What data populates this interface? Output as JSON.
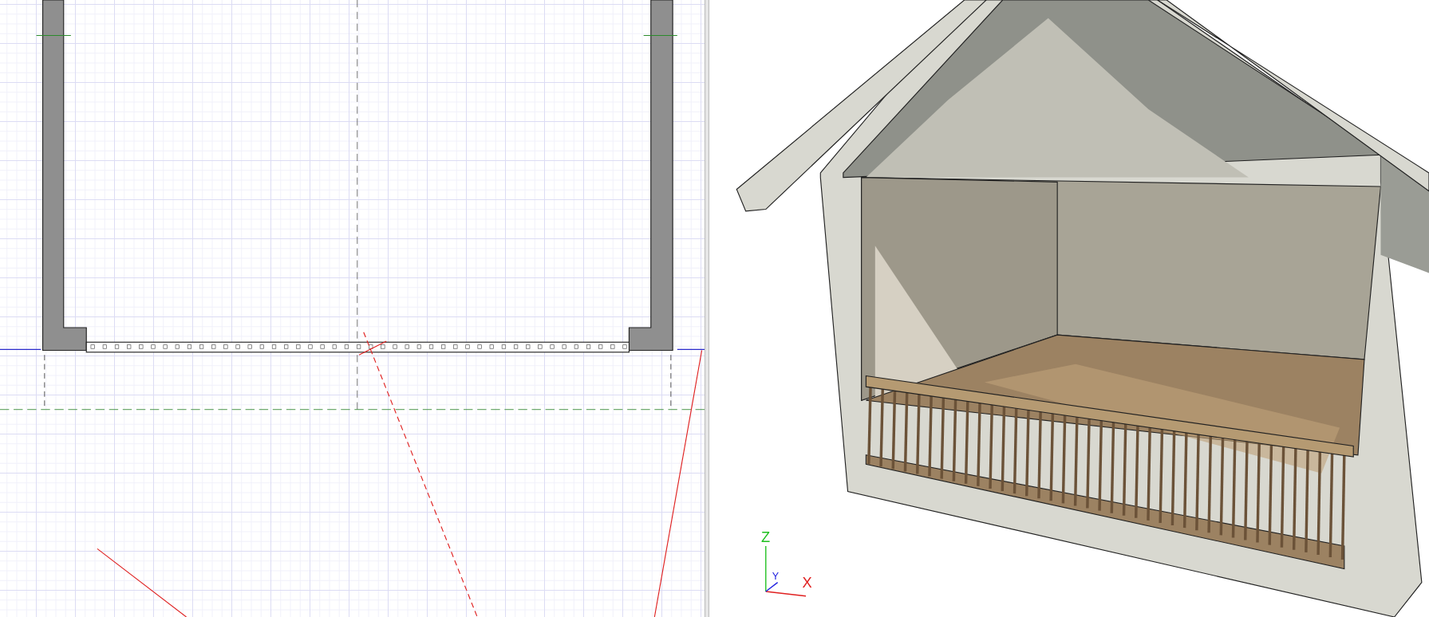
{
  "view_3d": {
    "axis_gizmo": {
      "z": "Z",
      "y": "Y",
      "x": "X"
    }
  }
}
